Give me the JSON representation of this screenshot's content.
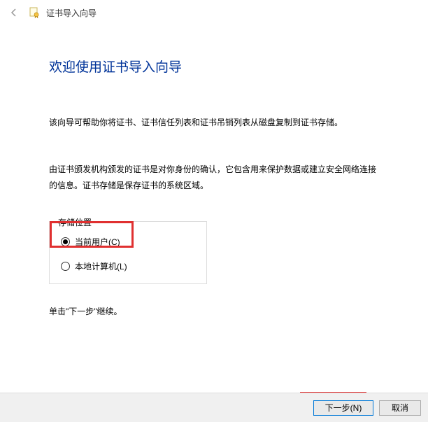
{
  "header": {
    "title": "证书导入向导"
  },
  "main": {
    "heading": "欢迎使用证书导入向导",
    "para1": "该向导可帮助你将证书、证书信任列表和证书吊销列表从磁盘复制到证书存储。",
    "para2": "由证书颁发机构颁发的证书是对你身份的确认，它包含用来保护数据或建立安全网络连接的信息。证书存储是保存证书的系统区域。",
    "fieldset_legend": "存储位置",
    "radio_current_user": "当前用户(C)",
    "radio_local_machine": "本地计算机(L)",
    "continue_hint": "单击\"下一步\"继续。"
  },
  "footer": {
    "next": "下一步(N)",
    "cancel": "取消"
  }
}
